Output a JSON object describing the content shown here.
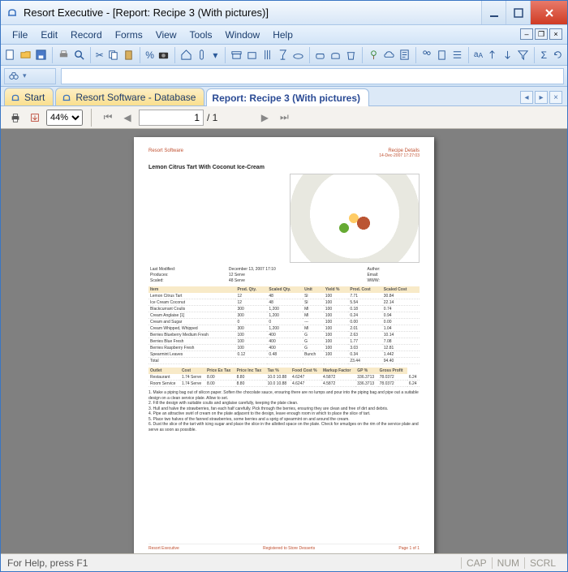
{
  "window": {
    "title": "Resort Executive - [Report: Recipe  3 (With pictures)]"
  },
  "menu": {
    "file": "File",
    "edit": "Edit",
    "record": "Record",
    "forms": "Forms",
    "view": "View",
    "tools": "Tools",
    "window": "Window",
    "help": "Help"
  },
  "tabs": {
    "t1": "Start",
    "t2": "Resort Software - Database",
    "t3": "Report: Recipe  3 (With pictures)"
  },
  "rpt_toolbar": {
    "zoom": "44%",
    "page": "1",
    "pages": "/ 1"
  },
  "report": {
    "header_left": "Resort Software",
    "header_right": "Recipe Details",
    "header_date": "14-Dec-2007    17:27:03",
    "title": "Lemon Citrus Tart With Coconut Ice-Cream",
    "meta": {
      "lm_label": "Last Modified:",
      "lm": "December 13, 2007   17:10",
      "author_label": "Author:",
      "prod_label": "Produces:",
      "prod": "12 Serve",
      "email_label": "Email:",
      "scaled_label": "Scaled:",
      "scaled": "48 Serve",
      "www_label": "WWW:"
    },
    "cols": [
      "Item",
      "Prod. Qty.",
      "Scaled Qty.",
      "Unit",
      "Yield %",
      "Prod. Cost",
      "Scaled Cost"
    ],
    "rows": [
      [
        "Lemon Citrus Tart",
        "12",
        "48",
        "Sl",
        "100",
        "7.71",
        "30.84"
      ],
      [
        "Ice Cream Coconut",
        "12",
        "48",
        "Sl",
        "100",
        "5.54",
        "22.14"
      ],
      [
        "Blackcurrant Coulis",
        "300",
        "1,200",
        "Ml",
        "100",
        "0.18",
        "0.74"
      ],
      [
        "Cream Anglaise [1]",
        "300",
        "1,200",
        "Ml",
        "100",
        "0.24",
        "0.94"
      ],
      [
        "Cream and Sugar",
        "0",
        "0",
        "---",
        "100",
        "0.00",
        "0.00"
      ],
      [
        "Cream Whipped, Whipped",
        "300",
        "1,200",
        "Ml",
        "100",
        "2.01",
        "1.04"
      ],
      [
        "Berries Blueberry Medium Fresh",
        "100",
        "400",
        "G",
        "100",
        "2.63",
        "10.14"
      ],
      [
        "Berries Blue Fresh",
        "100",
        "400",
        "G",
        "100",
        "1.77",
        "7.08"
      ],
      [
        "Berries Raspberry Fresh",
        "100",
        "400",
        "G",
        "100",
        "3.03",
        "12.81"
      ],
      [
        "Spearmint Leaves",
        "0.12",
        "0.48",
        "Bunch",
        "100",
        "0.34",
        "1.442"
      ],
      [
        "Total",
        "",
        "",
        "",
        "",
        "23.44",
        "94.40"
      ]
    ],
    "outlet_cols": [
      "Outlet",
      "Cost",
      "Price Ex Tax",
      "Price Inc Tax",
      "Tax %",
      "Food Cost %",
      "Markup Factor",
      "GP %",
      "Gross Profit"
    ],
    "outlet_rows": [
      [
        "Restaurant",
        "1.74 Serve",
        "8.00",
        "8.80",
        "10.0 10.88",
        "4.6247",
        "4.5872",
        "336.3713",
        "78.0372",
        "6.24"
      ],
      [
        "Room Service",
        "1.74 Serve",
        "8.00",
        "8.80",
        "10.0 10.88",
        "4.6247",
        "4.5872",
        "336.3713",
        "78.0372",
        "6.24"
      ]
    ],
    "instructions": [
      "1.  Make a piping bag out of silicon paper.  Soften the chocolate sauce, ensuring there are no lumps and pour into the piping bag and pipe out a suitable design on a clean service plate.  Allow to set.",
      "2.  Fill the design with suitable coulis and anglaise carefully, keeping the plate clean.",
      "3.  Hull and halve the strawberries, fan each half carefully.  Pick through the berries, ensuring they are clean and free of dirt and debris.",
      "4.  Pipe an attractive swirl of cream on the plate adjacent to the design, leave enough room in which to place the slice of tart.",
      "5.  Place two halves of the fanned strawberries, some berries and a sprig of spearmint on and around the cream.",
      "6.  Dust the slice of the tart with icing sugar and place the slice in the allotted space on the plate.  Check for smudges on the rim of the service plate and serve as soon as possible."
    ],
    "footer_left": "Resort Executive",
    "footer_mid": "Registered to Store Desserts",
    "footer_right": "Page 1 of 1"
  },
  "status": {
    "msg": "For Help, press F1",
    "cap": "CAP",
    "num": "NUM",
    "scrl": "SCRL"
  }
}
